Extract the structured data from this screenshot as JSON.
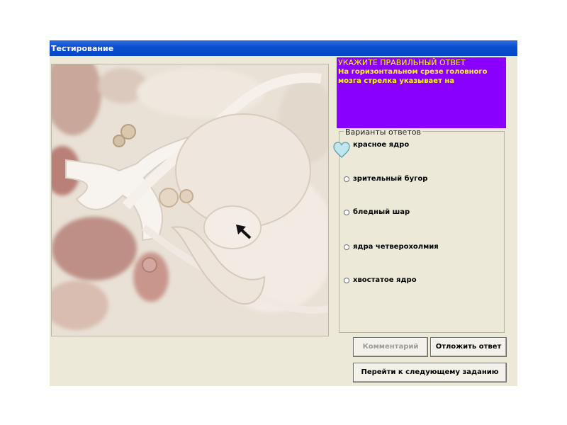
{
  "window": {
    "title": "Тестирование"
  },
  "question": {
    "heading": "УКАЖИТЕ ПРАВИЛЬНЫЙ ОТВЕТ",
    "text": "На горизонтальном срезе головного мозга стрелка указывает на"
  },
  "answers": {
    "group_title": "Варианты ответов",
    "options": [
      {
        "label": "красное ядро"
      },
      {
        "label": "зрительный бугор"
      },
      {
        "label": "бледный шар"
      },
      {
        "label": "ядра четверохолмия"
      },
      {
        "label": "хвостатое ядро"
      }
    ]
  },
  "buttons": {
    "comment": "Комментарий",
    "postpone": "Отложить ответ",
    "next": "Перейти к следующему заданию"
  },
  "colors": {
    "title_bar": "#0a4fd0",
    "question_bg": "#8a00ff",
    "question_text": "#ffff00",
    "window_bg": "#ece9d8"
  },
  "icons": {
    "selection_marker": "heart-icon",
    "pointer": "arrow-icon"
  }
}
